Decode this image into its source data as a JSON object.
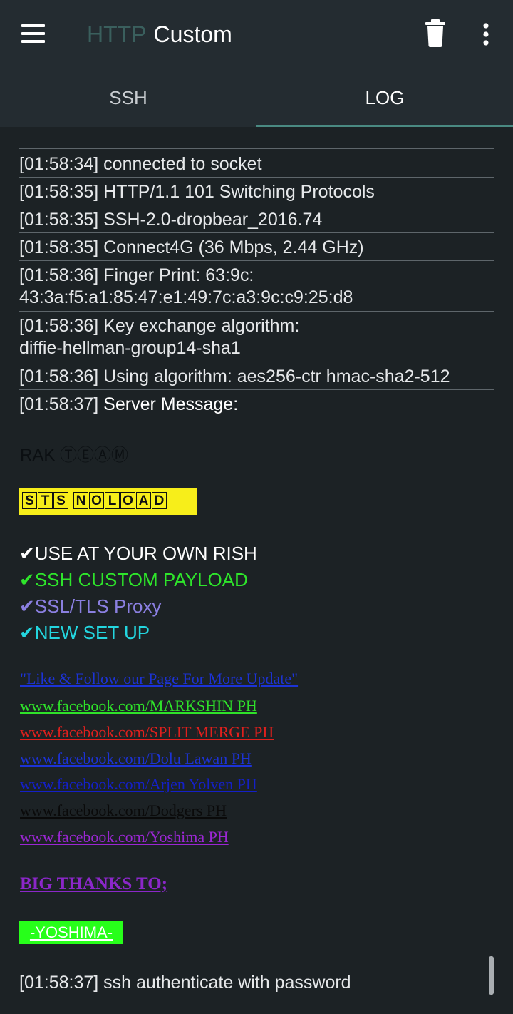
{
  "app": {
    "title_part1": "HTTP",
    "title_part2": "Custom"
  },
  "toolbar": {
    "menu_icon": "hamburger-menu-icon",
    "delete_icon": "trash-icon",
    "more_icon": "more-vert-icon"
  },
  "tabs": [
    {
      "label": "SSH",
      "active": false
    },
    {
      "label": "LOG",
      "active": true
    }
  ],
  "log": {
    "entries": [
      {
        "time": "[01:58:34]",
        "text": "connected to socket"
      },
      {
        "time": "[01:58:35]",
        "text": "HTTP/1.1 101 Switching Protocols"
      },
      {
        "time": "[01:58:35]",
        "text": "SSH-2.0-dropbear_2016.74"
      },
      {
        "time": "[01:58:35]",
        "text": "Connect4G (36 Mbps, 2.44 GHz)"
      },
      {
        "time": "[01:58:36]",
        "text": "Finger Print: 63:9c:",
        "text2": "43:3a:f5:a1:85:47:e1:49:7c:a3:9c:c9:25:d8"
      },
      {
        "time": "[01:58:36]",
        "text": "Key exchange algorithm:",
        "text2": "diffie-hellman-group14-sha1"
      },
      {
        "time": "[01:58:36]",
        "text": "Using algorithm: aes256-ctr hmac-sha2-512"
      },
      {
        "time": "[01:58:37]",
        "text": "Server Message:"
      }
    ],
    "last_entry": {
      "time": "[01:58:37]",
      "text": "ssh authenticate with password"
    }
  },
  "server_message": {
    "rak_team": "RAK ⓉⒺⒶⓂ",
    "badge_word1": [
      "S",
      "T",
      "S"
    ],
    "badge_word2": [
      "N",
      "O",
      "L",
      "O",
      "A",
      "D"
    ],
    "badge_color": "#f7ee1a",
    "check_items": [
      {
        "text": "✔USE AT YOUR OWN RISH",
        "color": "#ffffff"
      },
      {
        "text": "✔SSH CUSTOM PAYLOAD",
        "color": "#2ee52b"
      },
      {
        "text": "✔SSL/TLS Proxy",
        "color": "#8a7fe0"
      },
      {
        "text": "✔NEW SET UP",
        "color": "#23d6df"
      }
    ],
    "follow_note": "\"Like & Follow our Page For More Update\"",
    "links": [
      {
        "text": "www.facebook.com/MARKSHIN PH",
        "color": "#2fe22a"
      },
      {
        "text": "www.facebook.com/SPLIT MERGE PH",
        "color": "#e0201d"
      },
      {
        "text": "www.facebook.com/Dolu Lawan PH",
        "color": "#1c33d6"
      },
      {
        "text": "www.facebook.com/Arjen Yolven PH",
        "color": "#1420c8"
      },
      {
        "text": "www.facebook.com/Dodgers PH",
        "color": "#0a0a0a"
      },
      {
        "text": "www.facebook.com/Yoshima PH",
        "color": "#9b27d4"
      }
    ],
    "thanks": "BIG THANKS TO;",
    "yoshima": "-YOSHIMA-",
    "yoshima_bg": "#27ff1a"
  }
}
